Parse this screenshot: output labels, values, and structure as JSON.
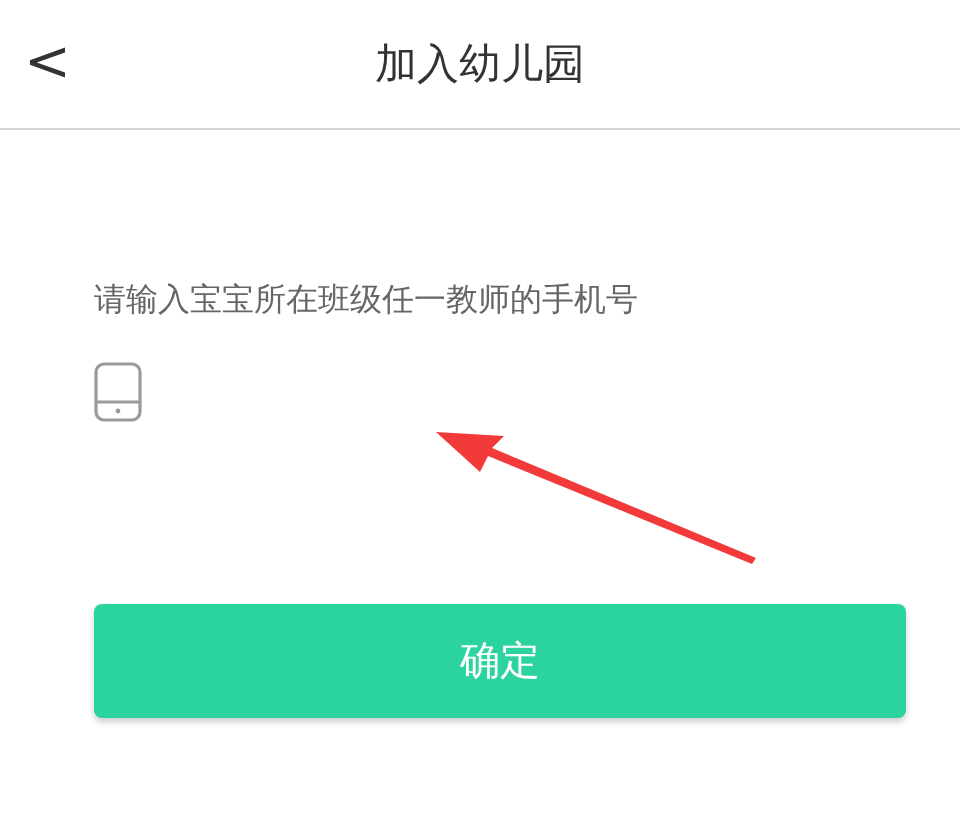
{
  "header": {
    "back": "<",
    "title": "加入幼儿园"
  },
  "form": {
    "prompt": "请输入宝宝所在班级任一教师的手机号"
  },
  "buttons": [
    "确定"
  ]
}
